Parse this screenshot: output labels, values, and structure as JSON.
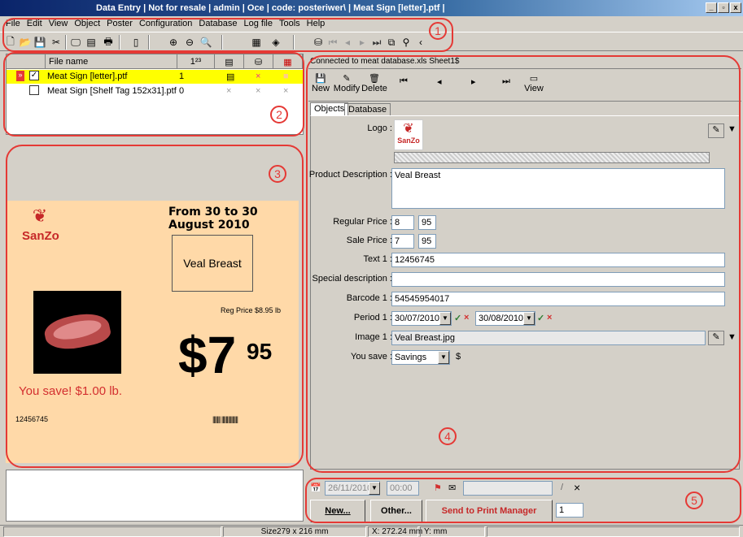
{
  "titlebar": {
    "title": "Data Entry | Not for resale | admin | Oce | code: posteriwer\\ | Meat Sign [letter].ptf |",
    "min": "_",
    "max": "▫",
    "close": "x"
  },
  "menu": [
    "File",
    "Edit",
    "View",
    "Object",
    "Poster",
    "Configuration",
    "Database",
    "Log file",
    "Tools",
    "Help"
  ],
  "callouts": [
    "1",
    "2",
    "3",
    "4",
    "5"
  ],
  "filelist": {
    "header": "File name",
    "col2": "1²³",
    "rows": [
      {
        "name": "Meat Sign [letter].ptf",
        "num": "1",
        "checked": "✓"
      },
      {
        "name": "Meat Sign [Shelf Tag 152x31].ptf",
        "num": "0",
        "checked": ""
      }
    ]
  },
  "sign": {
    "brand": "SanZo",
    "date_range": "From 30 to 30 August 2010",
    "product": "Veal Breast",
    "reg_price": "Reg Price $8.95 lb",
    "dollar": "$7",
    "cents": "95",
    "you_save": "You save! $1.00 lb.",
    "code": "12456745",
    "barcode": "||||||| |||||||||||||||"
  },
  "connection": "Connected to meat database.xls Sheet1$",
  "dbtools": {
    "new": "New",
    "modify": "Modify",
    "delete": "Delete",
    "view": "View"
  },
  "tabs": [
    "Objects",
    "Database"
  ],
  "form": {
    "logo_label": "Logo :",
    "desc_label": "Product Description :",
    "desc_value": "Veal Breast",
    "regular_label": "Regular Price :",
    "regular_dollars": "8",
    "regular_cents": "95",
    "sale_label": "Sale Price :",
    "sale_dollars": "7",
    "sale_cents": "95",
    "text1_label": "Text 1 :",
    "text1_value": "12456745",
    "special_label": "Special description :",
    "special_value": "",
    "barcode_label": "Barcode 1 :",
    "barcode_value": "54545954017",
    "period_label": "Period 1 :",
    "period_start": "30/07/2010",
    "period_end": "30/08/2010",
    "image_label": "Image 1 :",
    "image_value": "Veal Breast.jpg",
    "yousave_label": "You save :",
    "yousave_value": "Savings",
    "yousave_unit": "$"
  },
  "print": {
    "date": "26/11/2010",
    "time": "00:00",
    "new": "New...",
    "other": "Other...",
    "send": "Send to Print Manager",
    "copies": "1"
  },
  "status": {
    "size": "Size279 x 216 mm",
    "x": "X: 272.24 mm",
    "y": "Y:  mm"
  },
  "colors": {
    "selected_row": "#ffff00",
    "callout": "#e53935",
    "sign_bg": "#ffd9a8"
  }
}
